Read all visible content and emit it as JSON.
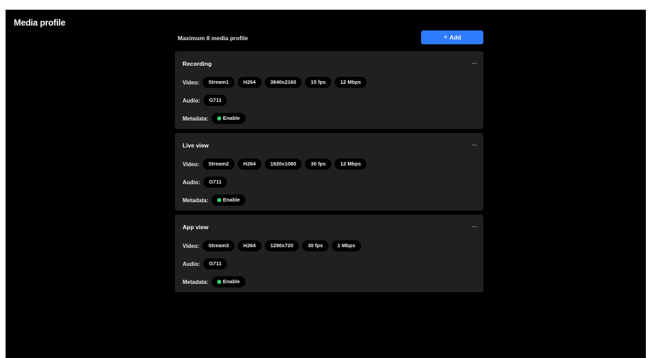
{
  "page": {
    "title": "Media profile"
  },
  "toolbar": {
    "max_label": "Maximum 8 media profile",
    "add_label": "Add",
    "add_color": "#2f7bff"
  },
  "labels": {
    "video": "Video:",
    "audio": "Audio:",
    "metadata": "Metadata:"
  },
  "status_color": "#3cd26b",
  "profiles": [
    {
      "name": "Recording",
      "video": [
        "Stream1",
        "H264",
        "3840x2160",
        "15 fps",
        "12 Mbps"
      ],
      "audio": "G711",
      "metadata": "Enable"
    },
    {
      "name": "Live view",
      "video": [
        "Stream2",
        "H264",
        "1920x1080",
        "30 fps",
        "12 Mbps"
      ],
      "audio": "G711",
      "metadata": "Enable"
    },
    {
      "name": "App view",
      "video": [
        "Stream3",
        "H264",
        "1280x720",
        "30 fps",
        "1 Mbps"
      ],
      "audio": "G711",
      "metadata": "Enable"
    }
  ]
}
